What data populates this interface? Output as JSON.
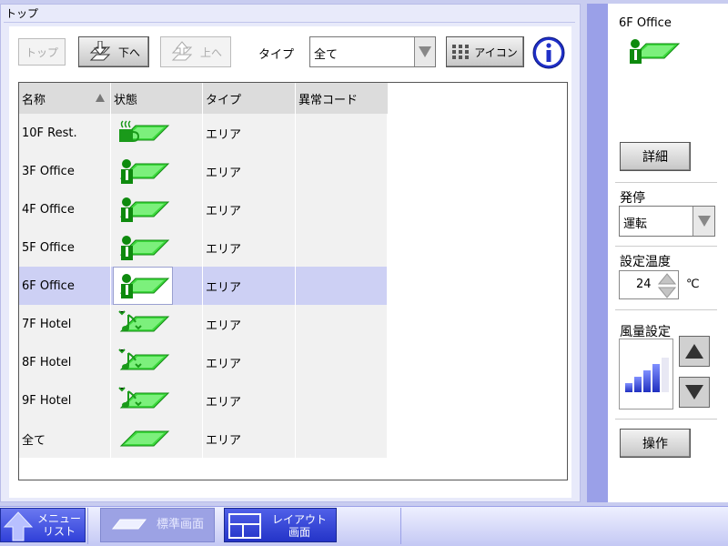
{
  "header": {
    "title": "トップ"
  },
  "toolbar": {
    "top_label": "トップ",
    "down_label": "下へ",
    "up_label": "上へ",
    "type_label": "タイプ",
    "type_value": "全て",
    "icon_label": "アイコン"
  },
  "table": {
    "columns": [
      "名称",
      "状態",
      "タイプ",
      "異常コード"
    ],
    "rows": [
      {
        "name": "10F Rest.",
        "icon": "restaurant-area-icon",
        "type": "エリア",
        "error": ""
      },
      {
        "name": "3F Office",
        "icon": "office-area-icon",
        "type": "エリア",
        "error": ""
      },
      {
        "name": "4F Office",
        "icon": "office-area-icon",
        "type": "エリア",
        "error": ""
      },
      {
        "name": "5F Office",
        "icon": "office-area-icon",
        "type": "エリア",
        "error": ""
      },
      {
        "name": "6F Office",
        "icon": "office-area-icon",
        "type": "エリア",
        "error": "",
        "selected": true
      },
      {
        "name": "7F Hotel",
        "icon": "hotel-area-icon",
        "type": "エリア",
        "error": ""
      },
      {
        "name": "8F Hotel",
        "icon": "hotel-area-icon",
        "type": "エリア",
        "error": ""
      },
      {
        "name": "9F Hotel",
        "icon": "hotel-area-icon",
        "type": "エリア",
        "error": ""
      },
      {
        "name": "全て",
        "icon": "all-area-icon",
        "type": "エリア",
        "error": ""
      }
    ]
  },
  "side": {
    "selected_name": "6F Office",
    "detail_label": "詳細",
    "onoff_label": "発停",
    "onoff_value": "運転",
    "temp_label": "設定温度",
    "temp_value": "24",
    "temp_unit": "℃",
    "fan_label": "風量設定",
    "fan_level_fraction": 0.8,
    "operate_label": "操作"
  },
  "bottom": {
    "menu_label_1": "メニュー",
    "menu_label_2": "リスト",
    "standard_label": "標準画面",
    "layout_label_1": "レイアウト",
    "layout_label_2": "画面"
  },
  "colors": {
    "accent": "#3030b0",
    "icon_green": "#2ec82e",
    "selected_row": "#cdd0f4"
  }
}
